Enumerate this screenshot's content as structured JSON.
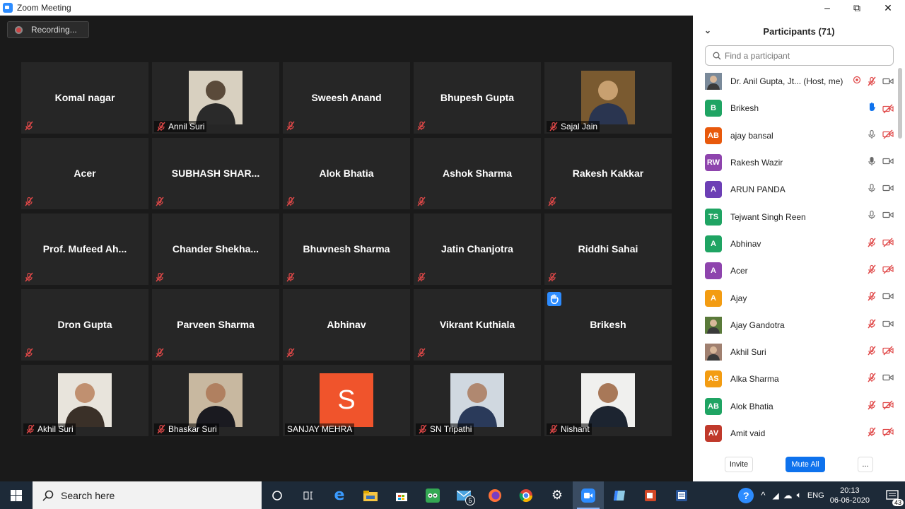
{
  "window": {
    "title": "Zoom Meeting",
    "minimize": "–",
    "restore": "⧉",
    "close": "✕"
  },
  "recording": {
    "label": "Recording..."
  },
  "tiles": [
    {
      "name": "Komal nagar"
    },
    {
      "label": "Annil Suri",
      "photo": "suit-man"
    },
    {
      "name": "Sweesh Anand"
    },
    {
      "name": "Bhupesh Gupta"
    },
    {
      "label": "Sajal Jain",
      "photo": "man-blazer"
    },
    {
      "name": "Acer"
    },
    {
      "name": "SUBHASH  SHAR..."
    },
    {
      "name": "Alok Bhatia"
    },
    {
      "name": "Ashok Sharma"
    },
    {
      "name": "Rakesh Kakkar"
    },
    {
      "name": "Prof. Mufeed Ah..."
    },
    {
      "name": "Chander  Shekha..."
    },
    {
      "name": "Bhuvnesh Sharma"
    },
    {
      "name": "Jatin Chanjotra"
    },
    {
      "name": "Riddhi Sahai"
    },
    {
      "name": "Dron Gupta"
    },
    {
      "name": "Parveen Sharma"
    },
    {
      "name": "Abhinav"
    },
    {
      "name": "Vikrant Kuthiala"
    },
    {
      "name": "Brikesh",
      "hand": true
    },
    {
      "label": "Akhil Suri",
      "photo": "young-man"
    },
    {
      "label": "Bhaskar Suri",
      "photo": "selfie-man"
    },
    {
      "label": "SANJAY MEHRA",
      "letter": "S"
    },
    {
      "label": "SN Tripathi",
      "photo": "man-tie"
    },
    {
      "label": "Nishant",
      "photo": "man-white"
    }
  ],
  "panel": {
    "title": "Participants (71)",
    "search_placeholder": "Find a participant",
    "participants": [
      {
        "name": "Dr. Anil Gupta, Jt... (Host, me)",
        "initials": "",
        "color": "#7a8a9a",
        "photo": true,
        "mic": "muted",
        "video": "off-plain",
        "record": true
      },
      {
        "name": "Brikesh",
        "initials": "B",
        "color": "#1fa463",
        "hand": true,
        "video": "off"
      },
      {
        "name": "ajay bansal",
        "initials": "AB",
        "color": "#e8590c",
        "mic": "on",
        "video": "off"
      },
      {
        "name": "Rakesh Wazir",
        "initials": "RW",
        "color": "#8e44ad",
        "mic": "speaking",
        "video": "plain"
      },
      {
        "name": "ARUN PANDA",
        "initials": "A",
        "color": "#6c3fb5",
        "mic": "on",
        "video": "plain"
      },
      {
        "name": "Tejwant Singh Reen",
        "initials": "TS",
        "color": "#1fa463",
        "mic": "on",
        "video": "plain"
      },
      {
        "name": "Abhinav",
        "initials": "A",
        "color": "#1fa463",
        "mic": "muted",
        "video": "off"
      },
      {
        "name": "Acer",
        "initials": "A",
        "color": "#8e44ad",
        "mic": "muted",
        "video": "off"
      },
      {
        "name": "Ajay",
        "initials": "A",
        "color": "#f39c12",
        "mic": "muted",
        "video": "plain"
      },
      {
        "name": "Ajay Gandotra",
        "initials": "",
        "color": "#5a7a3a",
        "photo": true,
        "mic": "muted",
        "video": "plain"
      },
      {
        "name": "Akhil Suri",
        "initials": "",
        "color": "#a08070",
        "photo": true,
        "mic": "muted",
        "video": "off"
      },
      {
        "name": "Alka Sharma",
        "initials": "AS",
        "color": "#f39c12",
        "mic": "muted",
        "video": "plain"
      },
      {
        "name": "Alok Bhatia",
        "initials": "AB",
        "color": "#1fa463",
        "mic": "muted",
        "video": "off"
      },
      {
        "name": "Amit vaid",
        "initials": "AV",
        "color": "#c0392b",
        "mic": "muted",
        "video": "off"
      }
    ],
    "invite": "Invite",
    "mute_all": "Mute All",
    "more": "..."
  },
  "taskbar": {
    "search": "Search here",
    "badge_mail": "5",
    "lang": "ENG",
    "time": "20:13",
    "date": "06-06-2020",
    "notif": "43"
  }
}
